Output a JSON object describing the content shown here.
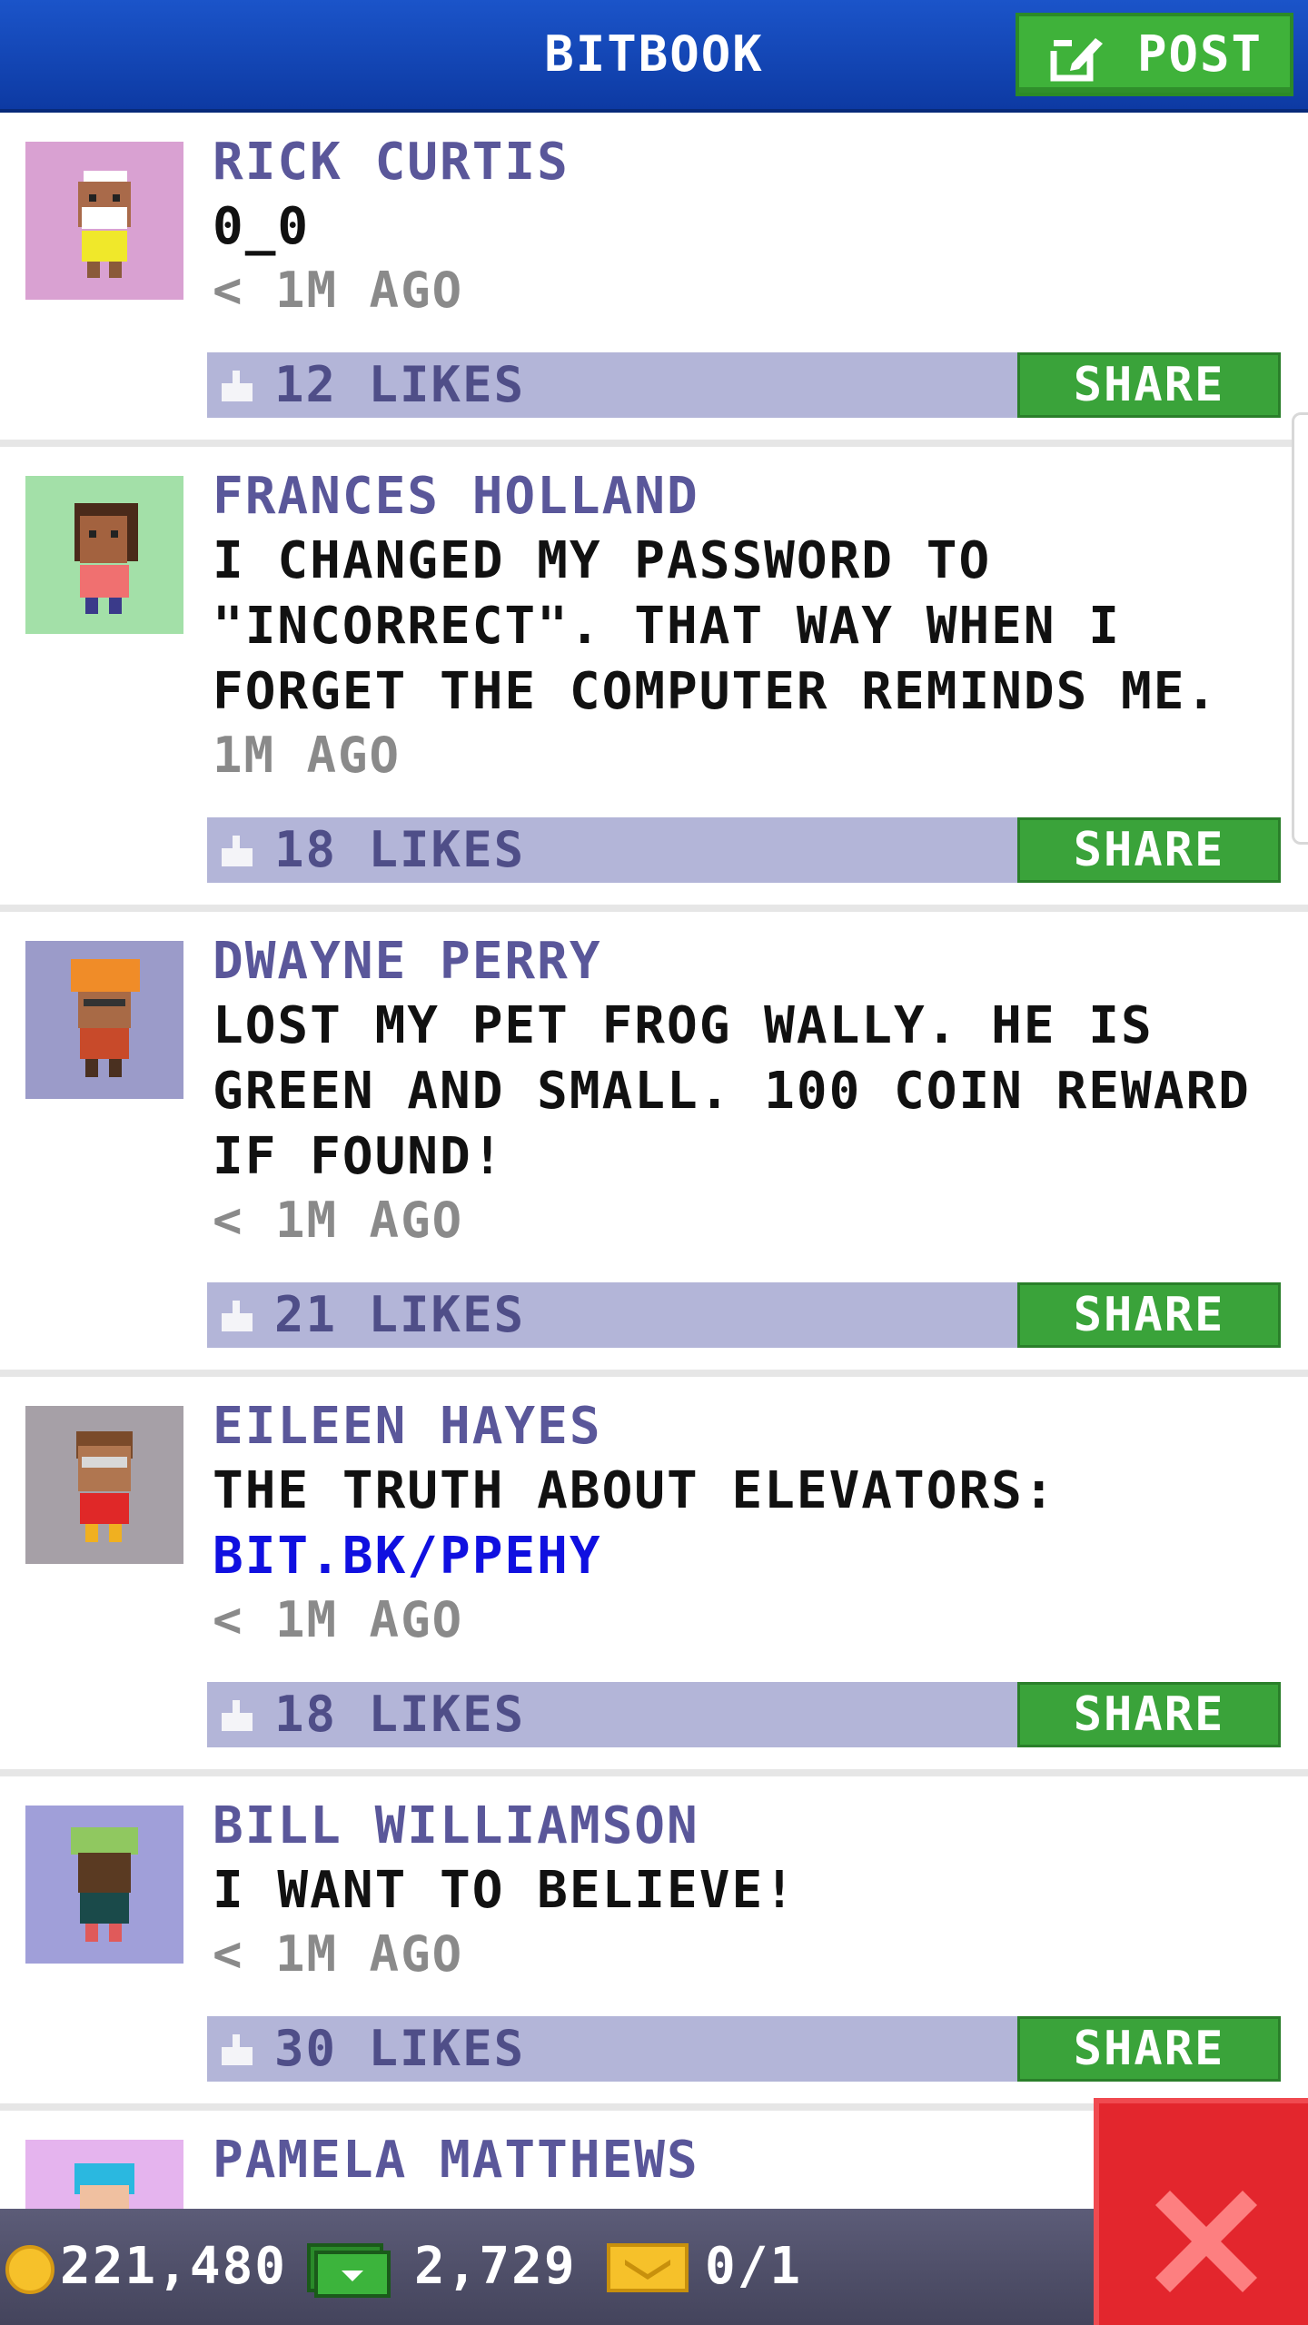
{
  "header": {
    "title": "BITBOOK",
    "post_label": "POST"
  },
  "posts": [
    {
      "name": "RICK CURTIS",
      "text": "0_0",
      "time": "< 1M AGO",
      "likes": "12 LIKES",
      "share": "SHARE",
      "avatar_bg": "#d9a1d2"
    },
    {
      "name": "FRANCES HOLLAND",
      "text": "I CHANGED MY PASSWORD TO\n\"INCORRECT\". THAT WAY WHEN I\nFORGET THE COMPUTER REMINDS ME.",
      "time": "1M AGO",
      "likes": "18 LIKES",
      "share": "SHARE",
      "avatar_bg": "#a3e0a8"
    },
    {
      "name": "DWAYNE PERRY",
      "text": "LOST MY PET FROG WALLY. HE IS\nGREEN AND SMALL. 100 COIN REWARD\nIF FOUND!",
      "time": "< 1M AGO",
      "likes": "21 LIKES",
      "share": "SHARE",
      "avatar_bg": "#9b9bc9"
    },
    {
      "name": "EILEEN HAYES",
      "text": "THE TRUTH ABOUT ELEVATORS:",
      "link": "BIT.BK/PPEHY",
      "time": "< 1M AGO",
      "likes": "18 LIKES",
      "share": "SHARE",
      "avatar_bg": "#a6a0a7"
    },
    {
      "name": "BILL WILLIAMSON",
      "text": "I WANT TO BELIEVE!",
      "time": "< 1M AGO",
      "likes": "30 LIKES",
      "share": "SHARE",
      "avatar_bg": "#a09fd9"
    },
    {
      "name": "PAMELA MATTHEWS",
      "avatar_bg": "#e5b4ee"
    }
  ],
  "stats": {
    "coins": "221,480",
    "bux": "2,729",
    "tickets": "0/1"
  },
  "colors": {
    "header": "#1b54c9",
    "accent_green": "#3aa33a",
    "likes_bar": "#b3b5d8",
    "close": "#e3262d"
  }
}
